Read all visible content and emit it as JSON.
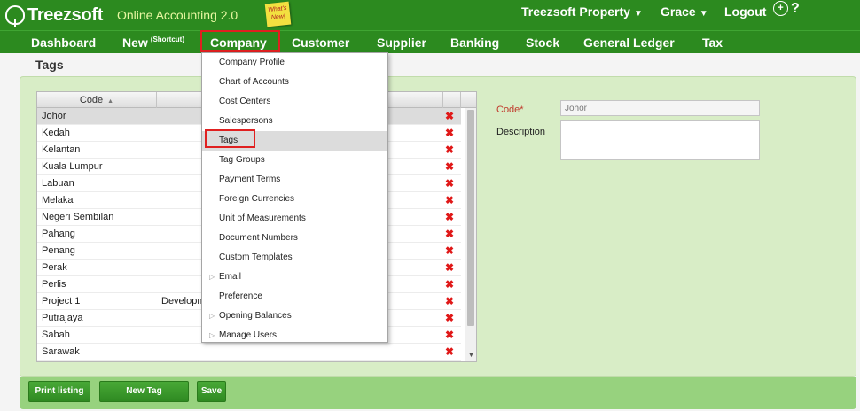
{
  "app": {
    "brand": "Treezsoft",
    "subtitle": "Online Accounting 2.0",
    "whatsnew": "What's New!"
  },
  "topright": {
    "property": "Treezsoft Property",
    "user": "Grace",
    "logout": "Logout",
    "add_user_glyph": "+",
    "help": "?"
  },
  "nav": {
    "dashboard": "Dashboard",
    "new": "New",
    "new_shortcut": "(Shortcut)",
    "company": "Company",
    "customer": "Customer",
    "supplier": "Supplier",
    "banking": "Banking",
    "stock": "Stock",
    "general_ledger": "General Ledger",
    "tax": "Tax"
  },
  "page_title": "Tags",
  "grid": {
    "columns": [
      "Code",
      ""
    ],
    "sort_glyph": "▲",
    "delete_glyph": "✖",
    "rows": [
      {
        "code": "Johor",
        "desc": ""
      },
      {
        "code": "Kedah",
        "desc": ""
      },
      {
        "code": "Kelantan",
        "desc": ""
      },
      {
        "code": "Kuala Lumpur",
        "desc": ""
      },
      {
        "code": "Labuan",
        "desc": ""
      },
      {
        "code": "Melaka",
        "desc": ""
      },
      {
        "code": "Negeri Sembilan",
        "desc": ""
      },
      {
        "code": "Pahang",
        "desc": ""
      },
      {
        "code": "Penang",
        "desc": ""
      },
      {
        "code": "Perak",
        "desc": ""
      },
      {
        "code": "Perlis",
        "desc": ""
      },
      {
        "code": "Project 1",
        "desc": "Developm"
      },
      {
        "code": "Putrajaya",
        "desc": ""
      },
      {
        "code": "Sabah",
        "desc": ""
      },
      {
        "code": "Sarawak",
        "desc": ""
      }
    ]
  },
  "form": {
    "code_label": "Code*",
    "code_value": "Johor",
    "description_label": "Description",
    "description_value": ""
  },
  "buttons": {
    "print_listing": "Print listing",
    "new_tag": "New Tag",
    "save": "Save"
  },
  "company_menu": {
    "items": [
      {
        "label": "Company Profile",
        "submenu": false
      },
      {
        "label": "Chart of Accounts",
        "submenu": false
      },
      {
        "label": "Cost Centers",
        "submenu": false
      },
      {
        "label": "Salespersons",
        "submenu": false
      },
      {
        "label": "Tags",
        "submenu": false
      },
      {
        "label": "Tag Groups",
        "submenu": false
      },
      {
        "label": "Payment Terms",
        "submenu": false
      },
      {
        "label": "Foreign Currencies",
        "submenu": false
      },
      {
        "label": "Unit of Measurements",
        "submenu": false
      },
      {
        "label": "Document Numbers",
        "submenu": false
      },
      {
        "label": "Custom Templates",
        "submenu": false
      },
      {
        "label": "Email",
        "submenu": true
      },
      {
        "label": "Preference",
        "submenu": false
      },
      {
        "label": "Opening Balances",
        "submenu": true
      },
      {
        "label": "Manage Users",
        "submenu": true
      }
    ],
    "submenu_glyph": "▷"
  },
  "colors": {
    "brand_green": "#2c8a1f",
    "panel_green": "#d8edc6",
    "highlight_red": "#e02020"
  }
}
